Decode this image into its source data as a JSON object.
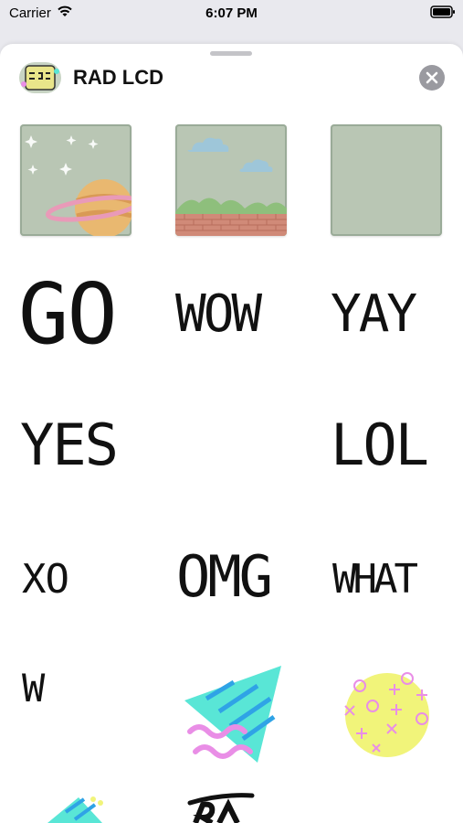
{
  "status_bar": {
    "carrier": "Carrier",
    "time": "6:07 PM"
  },
  "app": {
    "title": "RAD LCD"
  },
  "stickers": {
    "text": {
      "go": "GO",
      "wow": "WOW",
      "yay": "YAY",
      "yes": "YES",
      "lol": "LOL",
      "xo": "XO",
      "omg": "OMG",
      "what": "WHAT",
      "w": "W"
    }
  },
  "colors": {
    "sheet": "#ffffff",
    "lcd_tile": "#b9c6b4",
    "accent_cyan": "#59e6d6",
    "accent_pink": "#e98ee6",
    "accent_yellow": "#f1f47a"
  }
}
